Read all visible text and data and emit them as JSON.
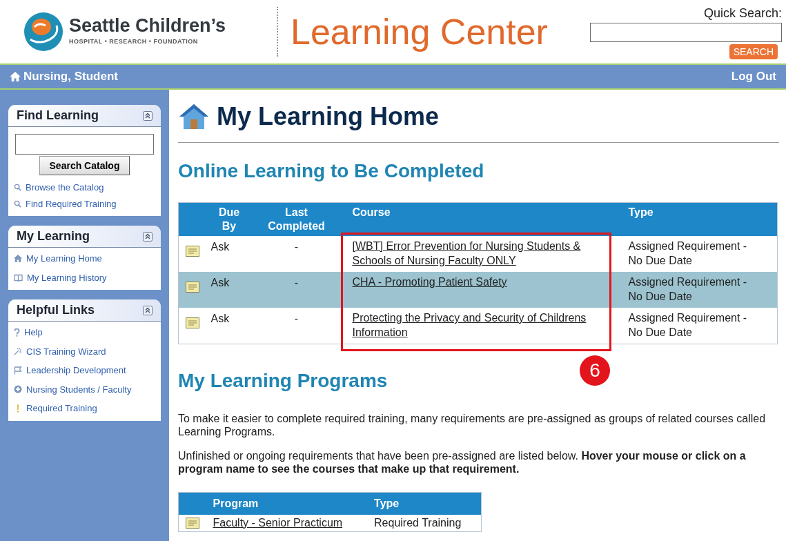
{
  "header": {
    "org_name": "Seattle Children’s",
    "org_tagline": "HOSPITAL • RESEARCH • FOUNDATION",
    "app_title": "Learning Center",
    "quick_search": {
      "label": "Quick Search:",
      "button": "SEARCH"
    }
  },
  "nav_bar": {
    "user": "Nursing, Student",
    "logout": "Log Out"
  },
  "sidebar": [
    {
      "title": "Find Learning",
      "kind": "search",
      "button": "Search Catalog",
      "items": [
        {
          "label": "Browse the Catalog"
        },
        {
          "label": "Find Required Training"
        }
      ]
    },
    {
      "title": "My Learning",
      "kind": "links",
      "items": [
        {
          "label": "My Learning Home"
        },
        {
          "label": "My Learning History"
        }
      ]
    },
    {
      "title": "Helpful Links",
      "kind": "links",
      "items": [
        {
          "label": "Help"
        },
        {
          "label": "CIS Training Wizard"
        },
        {
          "label": "Leadership Development"
        },
        {
          "label": "Nursing Students / Faculty"
        },
        {
          "label": "Required Training"
        }
      ]
    }
  ],
  "page_title": "My Learning Home",
  "online_learning": {
    "heading": "Online Learning to Be Completed",
    "columns": [
      "Due By",
      "Last Completed",
      "Course",
      "Type"
    ],
    "rows": [
      {
        "due_by": "Ask",
        "last_completed": "-",
        "course": "[WBT] Error Prevention for Nursing Students & Schools of Nursing Faculty ONLY",
        "type": "Assigned Requirement - No Due Date",
        "shaded": false
      },
      {
        "due_by": "Ask",
        "last_completed": "-",
        "course": "CHA - Promoting Patient Safety",
        "type": "Assigned Requirement - No Due Date",
        "shaded": true
      },
      {
        "due_by": "Ask",
        "last_completed": "-",
        "course": "Protecting the Privacy and Security of Childrens Information",
        "type": "Assigned Requirement - No Due Date",
        "shaded": false
      }
    ],
    "callout": {
      "number": "6"
    }
  },
  "programs": {
    "heading": "My Learning Programs",
    "intro": "To make it easier to complete required training, many requirements are pre-assigned as groups of related courses called Learning Programs.",
    "note": "Unfinished or ongoing requirements that have been pre-assigned are listed below. **Hover your mouse or click on a program name to see the courses that make up that requirement.**",
    "columns": [
      "Program",
      "Type"
    ],
    "rows": [
      {
        "program": "Faculty - Senior Practicum",
        "type": "Required Training"
      }
    ]
  }
}
